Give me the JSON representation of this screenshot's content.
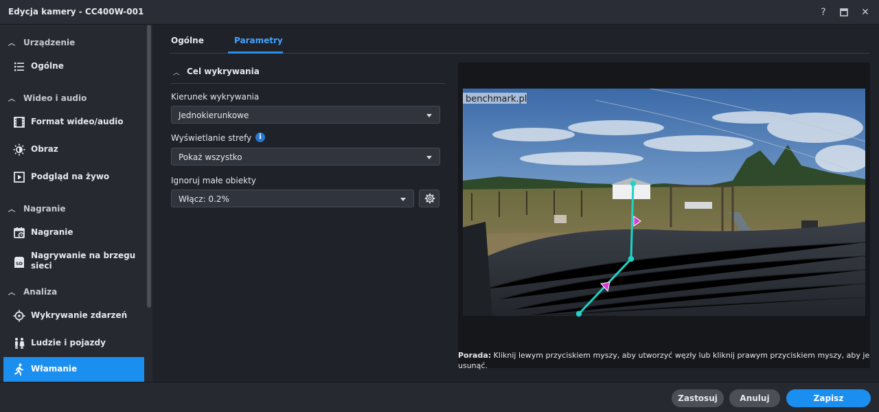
{
  "window": {
    "title": "Edycja kamery - CC400W-001",
    "help": "?",
    "close": "✕"
  },
  "sidebar": {
    "sections": [
      {
        "label": "Urządzenie"
      },
      {
        "label": "Wideo i audio"
      },
      {
        "label": "Nagranie"
      },
      {
        "label": "Analiza"
      }
    ],
    "items": [
      {
        "label": "Ogólne",
        "icon": "list-icon"
      },
      {
        "label": "Format wideo/audio",
        "icon": "film-icon"
      },
      {
        "label": "Obraz",
        "icon": "brightness-icon"
      },
      {
        "label": "Podgląd na żywo",
        "icon": "play-icon"
      },
      {
        "label": "Nagranie",
        "icon": "calendar-record-icon"
      },
      {
        "label": "Nagrywanie na brzegu sieci",
        "icon": "sd-card-icon"
      },
      {
        "label": "Wykrywanie zdarzeń",
        "icon": "crosshair-icon"
      },
      {
        "label": "Ludzie i pojazdy",
        "icon": "people-icon"
      },
      {
        "label": "Włamanie",
        "icon": "walking-person-icon",
        "active": true
      }
    ]
  },
  "tabs": [
    {
      "label": "Ogólne",
      "active": false
    },
    {
      "label": "Parametry",
      "active": true
    }
  ],
  "panel": {
    "title": "Cel wykrywania",
    "direction": {
      "label": "Kierunek wykrywania",
      "value": "Jednokierunkowe"
    },
    "zone": {
      "label": "Wyświetlanie strefy",
      "value": "Pokaż wszystko",
      "info": "i"
    },
    "ignore": {
      "label": "Ignoruj małe obiekty",
      "value": "Włącz: 0.2%"
    }
  },
  "preview": {
    "watermark": "benchmark.pl",
    "tip_bold": "Porada:",
    "tip_text": " Kliknij lewym przyciskiem myszy, aby utworzyć węzły lub kliknij prawym przyciskiem myszy, aby je usunąć."
  },
  "footer": {
    "apply": "Zastosuj",
    "cancel": "Anuluj",
    "save": "Zapisz"
  },
  "colors": {
    "accent": "#1b8ff0",
    "line": "#1fd3c6",
    "arrow": "#d93ad9"
  }
}
